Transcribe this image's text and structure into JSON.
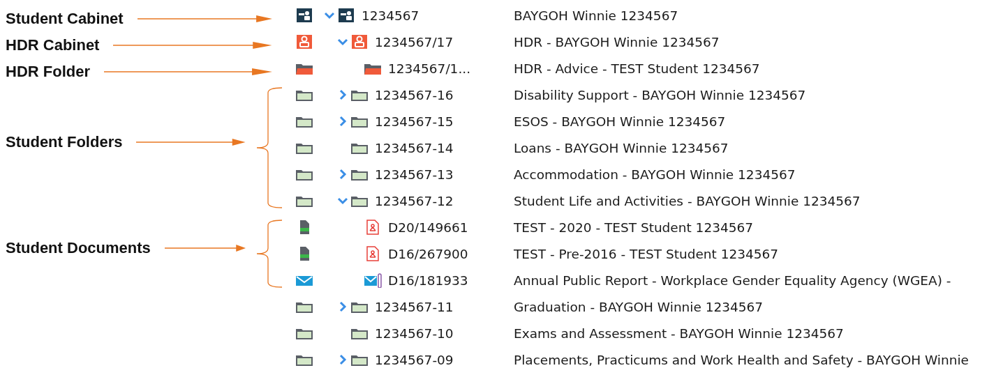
{
  "annotations": [
    {
      "label": "Student Cabinet",
      "kind": "arrow"
    },
    {
      "label": "HDR Cabinet",
      "kind": "arrow"
    },
    {
      "label": "HDR Folder",
      "kind": "arrow"
    },
    {
      "label": "Student Folders",
      "kind": "bracket"
    },
    {
      "label": "Student Documents",
      "kind": "bracket"
    }
  ],
  "tree": [
    {
      "kind": "cabinet",
      "id": "1234567",
      "title": "BAYGOH Winnie 1234567",
      "expanded": true,
      "children": [
        {
          "kind": "hdr-cabinet",
          "id": "1234567/17",
          "title": "HDR - BAYGOH Winnie 1234567",
          "expanded": true,
          "children": [
            {
              "kind": "hdr-folder",
              "id": "1234567/1...",
              "title": "HDR - Advice - TEST Student 1234567"
            }
          ]
        },
        {
          "kind": "folder",
          "id": "1234567-16",
          "title": "Disability Support - BAYGOH Winnie 1234567",
          "expanded": false
        },
        {
          "kind": "folder",
          "id": "1234567-15",
          "title": "ESOS - BAYGOH Winnie 1234567",
          "expanded": false
        },
        {
          "kind": "folder",
          "id": "1234567-14",
          "title": "Loans - BAYGOH Winnie 1234567"
        },
        {
          "kind": "folder",
          "id": "1234567-13",
          "title": "Accommodation - BAYGOH Winnie 1234567",
          "expanded": false
        },
        {
          "kind": "folder",
          "id": "1234567-12",
          "title": "Student Life and Activities - BAYGOH Winnie 1234567",
          "expanded": true,
          "children": [
            {
              "kind": "pdf",
              "id": "D20/149661",
              "title": "TEST - 2020 - TEST Student 1234567"
            },
            {
              "kind": "pdf",
              "id": "D16/267900",
              "title": "TEST - Pre-2016 - TEST Student 1234567"
            },
            {
              "kind": "email",
              "id": "D16/181933",
              "title": "Annual Public Report - Workplace Gender Equality Agency (WGEA) -"
            }
          ]
        },
        {
          "kind": "folder",
          "id": "1234567-11",
          "title": "Graduation - BAYGOH Winnie 1234567",
          "expanded": false
        },
        {
          "kind": "folder",
          "id": "1234567-10",
          "title": "Exams and Assessment - BAYGOH Winnie 1234567"
        },
        {
          "kind": "folder",
          "id": "1234567-09",
          "title": "Placements, Practicums and Work Health and Safety - BAYGOH Winnie",
          "expanded": false
        }
      ]
    }
  ]
}
